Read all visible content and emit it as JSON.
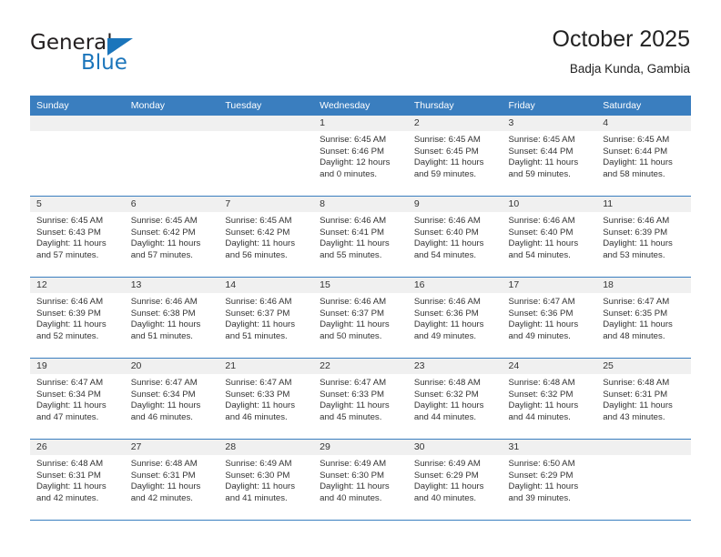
{
  "brand": {
    "name_part1": "General",
    "name_part2": "Blue",
    "logo_icon": "triangle-icon",
    "accent_color": "#1b75bb"
  },
  "header": {
    "title": "October 2025",
    "subtitle": "Badja Kunda, Gambia"
  },
  "theme": {
    "header_row_bg": "#3a7ebf",
    "daynum_band_bg": "#f0f0f0",
    "grid_line": "#3a7ebf",
    "text": "#333333"
  },
  "weekday_headers": [
    "Sunday",
    "Monday",
    "Tuesday",
    "Wednesday",
    "Thursday",
    "Friday",
    "Saturday"
  ],
  "labels": {
    "sunrise_prefix": "Sunrise:",
    "sunset_prefix": "Sunset:",
    "daylight_prefix": "Daylight:"
  },
  "weeks": [
    [
      {
        "day": "",
        "sunrise": "",
        "sunset": "",
        "daylight_line1": "",
        "daylight_line2": ""
      },
      {
        "day": "",
        "sunrise": "",
        "sunset": "",
        "daylight_line1": "",
        "daylight_line2": ""
      },
      {
        "day": "",
        "sunrise": "",
        "sunset": "",
        "daylight_line1": "",
        "daylight_line2": ""
      },
      {
        "day": "1",
        "sunrise": "Sunrise: 6:45 AM",
        "sunset": "Sunset: 6:46 PM",
        "daylight_line1": "Daylight: 12 hours",
        "daylight_line2": "and 0 minutes."
      },
      {
        "day": "2",
        "sunrise": "Sunrise: 6:45 AM",
        "sunset": "Sunset: 6:45 PM",
        "daylight_line1": "Daylight: 11 hours",
        "daylight_line2": "and 59 minutes."
      },
      {
        "day": "3",
        "sunrise": "Sunrise: 6:45 AM",
        "sunset": "Sunset: 6:44 PM",
        "daylight_line1": "Daylight: 11 hours",
        "daylight_line2": "and 59 minutes."
      },
      {
        "day": "4",
        "sunrise": "Sunrise: 6:45 AM",
        "sunset": "Sunset: 6:44 PM",
        "daylight_line1": "Daylight: 11 hours",
        "daylight_line2": "and 58 minutes."
      }
    ],
    [
      {
        "day": "5",
        "sunrise": "Sunrise: 6:45 AM",
        "sunset": "Sunset: 6:43 PM",
        "daylight_line1": "Daylight: 11 hours",
        "daylight_line2": "and 57 minutes."
      },
      {
        "day": "6",
        "sunrise": "Sunrise: 6:45 AM",
        "sunset": "Sunset: 6:42 PM",
        "daylight_line1": "Daylight: 11 hours",
        "daylight_line2": "and 57 minutes."
      },
      {
        "day": "7",
        "sunrise": "Sunrise: 6:45 AM",
        "sunset": "Sunset: 6:42 PM",
        "daylight_line1": "Daylight: 11 hours",
        "daylight_line2": "and 56 minutes."
      },
      {
        "day": "8",
        "sunrise": "Sunrise: 6:46 AM",
        "sunset": "Sunset: 6:41 PM",
        "daylight_line1": "Daylight: 11 hours",
        "daylight_line2": "and 55 minutes."
      },
      {
        "day": "9",
        "sunrise": "Sunrise: 6:46 AM",
        "sunset": "Sunset: 6:40 PM",
        "daylight_line1": "Daylight: 11 hours",
        "daylight_line2": "and 54 minutes."
      },
      {
        "day": "10",
        "sunrise": "Sunrise: 6:46 AM",
        "sunset": "Sunset: 6:40 PM",
        "daylight_line1": "Daylight: 11 hours",
        "daylight_line2": "and 54 minutes."
      },
      {
        "day": "11",
        "sunrise": "Sunrise: 6:46 AM",
        "sunset": "Sunset: 6:39 PM",
        "daylight_line1": "Daylight: 11 hours",
        "daylight_line2": "and 53 minutes."
      }
    ],
    [
      {
        "day": "12",
        "sunrise": "Sunrise: 6:46 AM",
        "sunset": "Sunset: 6:39 PM",
        "daylight_line1": "Daylight: 11 hours",
        "daylight_line2": "and 52 minutes."
      },
      {
        "day": "13",
        "sunrise": "Sunrise: 6:46 AM",
        "sunset": "Sunset: 6:38 PM",
        "daylight_line1": "Daylight: 11 hours",
        "daylight_line2": "and 51 minutes."
      },
      {
        "day": "14",
        "sunrise": "Sunrise: 6:46 AM",
        "sunset": "Sunset: 6:37 PM",
        "daylight_line1": "Daylight: 11 hours",
        "daylight_line2": "and 51 minutes."
      },
      {
        "day": "15",
        "sunrise": "Sunrise: 6:46 AM",
        "sunset": "Sunset: 6:37 PM",
        "daylight_line1": "Daylight: 11 hours",
        "daylight_line2": "and 50 minutes."
      },
      {
        "day": "16",
        "sunrise": "Sunrise: 6:46 AM",
        "sunset": "Sunset: 6:36 PM",
        "daylight_line1": "Daylight: 11 hours",
        "daylight_line2": "and 49 minutes."
      },
      {
        "day": "17",
        "sunrise": "Sunrise: 6:47 AM",
        "sunset": "Sunset: 6:36 PM",
        "daylight_line1": "Daylight: 11 hours",
        "daylight_line2": "and 49 minutes."
      },
      {
        "day": "18",
        "sunrise": "Sunrise: 6:47 AM",
        "sunset": "Sunset: 6:35 PM",
        "daylight_line1": "Daylight: 11 hours",
        "daylight_line2": "and 48 minutes."
      }
    ],
    [
      {
        "day": "19",
        "sunrise": "Sunrise: 6:47 AM",
        "sunset": "Sunset: 6:34 PM",
        "daylight_line1": "Daylight: 11 hours",
        "daylight_line2": "and 47 minutes."
      },
      {
        "day": "20",
        "sunrise": "Sunrise: 6:47 AM",
        "sunset": "Sunset: 6:34 PM",
        "daylight_line1": "Daylight: 11 hours",
        "daylight_line2": "and 46 minutes."
      },
      {
        "day": "21",
        "sunrise": "Sunrise: 6:47 AM",
        "sunset": "Sunset: 6:33 PM",
        "daylight_line1": "Daylight: 11 hours",
        "daylight_line2": "and 46 minutes."
      },
      {
        "day": "22",
        "sunrise": "Sunrise: 6:47 AM",
        "sunset": "Sunset: 6:33 PM",
        "daylight_line1": "Daylight: 11 hours",
        "daylight_line2": "and 45 minutes."
      },
      {
        "day": "23",
        "sunrise": "Sunrise: 6:48 AM",
        "sunset": "Sunset: 6:32 PM",
        "daylight_line1": "Daylight: 11 hours",
        "daylight_line2": "and 44 minutes."
      },
      {
        "day": "24",
        "sunrise": "Sunrise: 6:48 AM",
        "sunset": "Sunset: 6:32 PM",
        "daylight_line1": "Daylight: 11 hours",
        "daylight_line2": "and 44 minutes."
      },
      {
        "day": "25",
        "sunrise": "Sunrise: 6:48 AM",
        "sunset": "Sunset: 6:31 PM",
        "daylight_line1": "Daylight: 11 hours",
        "daylight_line2": "and 43 minutes."
      }
    ],
    [
      {
        "day": "26",
        "sunrise": "Sunrise: 6:48 AM",
        "sunset": "Sunset: 6:31 PM",
        "daylight_line1": "Daylight: 11 hours",
        "daylight_line2": "and 42 minutes."
      },
      {
        "day": "27",
        "sunrise": "Sunrise: 6:48 AM",
        "sunset": "Sunset: 6:31 PM",
        "daylight_line1": "Daylight: 11 hours",
        "daylight_line2": "and 42 minutes."
      },
      {
        "day": "28",
        "sunrise": "Sunrise: 6:49 AM",
        "sunset": "Sunset: 6:30 PM",
        "daylight_line1": "Daylight: 11 hours",
        "daylight_line2": "and 41 minutes."
      },
      {
        "day": "29",
        "sunrise": "Sunrise: 6:49 AM",
        "sunset": "Sunset: 6:30 PM",
        "daylight_line1": "Daylight: 11 hours",
        "daylight_line2": "and 40 minutes."
      },
      {
        "day": "30",
        "sunrise": "Sunrise: 6:49 AM",
        "sunset": "Sunset: 6:29 PM",
        "daylight_line1": "Daylight: 11 hours",
        "daylight_line2": "and 40 minutes."
      },
      {
        "day": "31",
        "sunrise": "Sunrise: 6:50 AM",
        "sunset": "Sunset: 6:29 PM",
        "daylight_line1": "Daylight: 11 hours",
        "daylight_line2": "and 39 minutes."
      },
      {
        "day": "",
        "sunrise": "",
        "sunset": "",
        "daylight_line1": "",
        "daylight_line2": ""
      }
    ]
  ]
}
